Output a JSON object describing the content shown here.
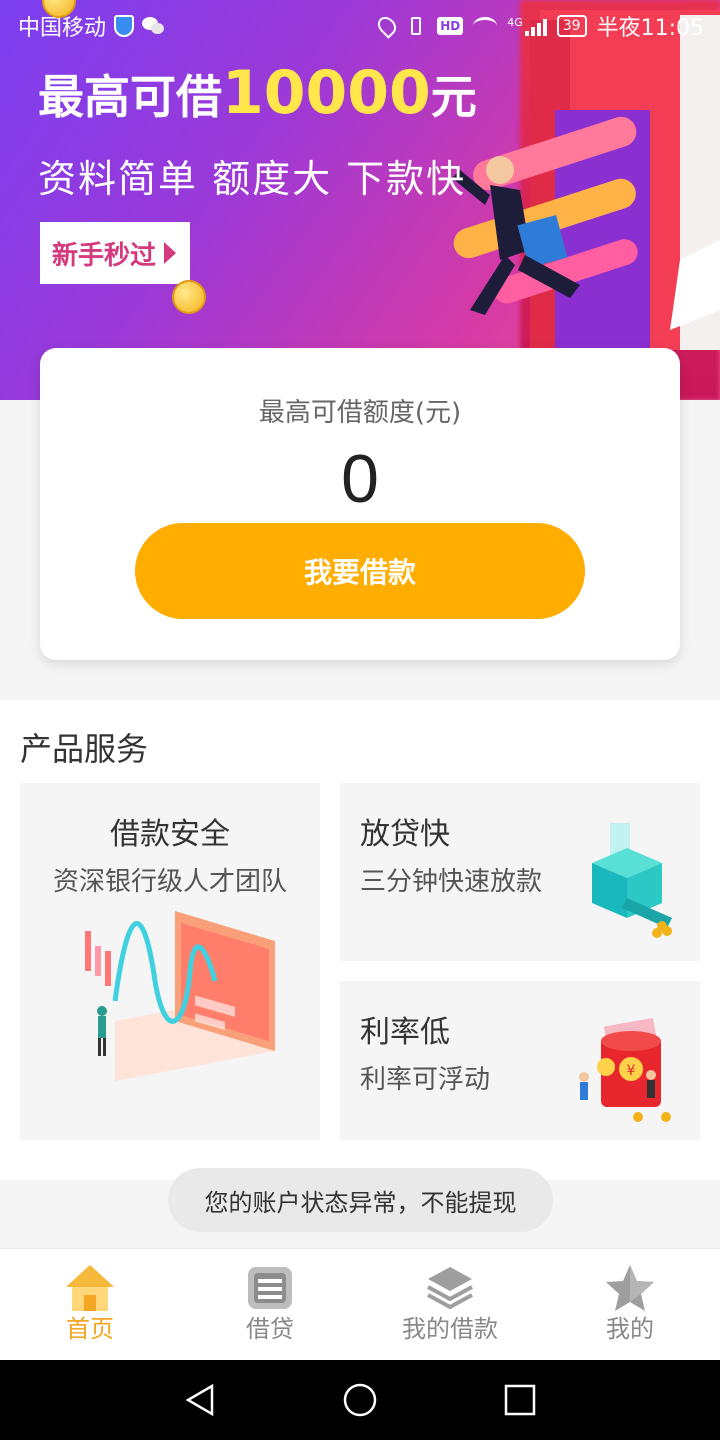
{
  "status_bar": {
    "carrier": "中国移动",
    "hd_badge": "HD",
    "network": "4G",
    "battery": "39",
    "time": "半夜11:05"
  },
  "banner": {
    "title_prefix": "最高可借",
    "title_amount": "10000",
    "title_suffix": "元",
    "subtitle": "资料简单 额度大 下款快",
    "cta": "新手秒过"
  },
  "credit_card": {
    "label": "最高可借额度(元)",
    "value": "0",
    "borrow_button": "我要借款"
  },
  "services": {
    "heading": "产品服务",
    "items": [
      {
        "title": "借款安全",
        "desc": "资深银行级人才团队"
      },
      {
        "title": "放贷快",
        "desc": "三分钟快速放款"
      },
      {
        "title": "利率低",
        "desc": "利率可浮动"
      }
    ]
  },
  "toast": "您的账户状态异常，不能提现",
  "tab_bar": {
    "active_color": "#f5a623",
    "tabs": [
      {
        "label": "首页",
        "icon": "home-icon",
        "active": true
      },
      {
        "label": "借贷",
        "icon": "loan-icon",
        "active": false
      },
      {
        "label": "我的借款",
        "icon": "layers-icon",
        "active": false
      },
      {
        "label": "我的",
        "icon": "star-icon",
        "active": false
      }
    ]
  },
  "colors": {
    "accent": "#ffad00",
    "banner_gradient_start": "#7b3ff0",
    "banner_gradient_end": "#f05a8a",
    "amount_highlight": "#ffe64a"
  }
}
